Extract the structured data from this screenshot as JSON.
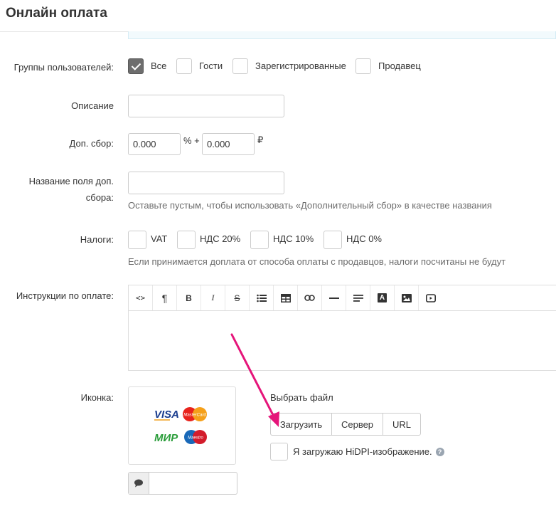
{
  "page": {
    "title": "Онлайн оплата"
  },
  "user_groups": {
    "label": "Группы пользователей:",
    "options": [
      {
        "label": "Все",
        "checked": true
      },
      {
        "label": "Гости",
        "checked": false
      },
      {
        "label": "Зарегистрированные",
        "checked": false
      },
      {
        "label": "Продавец",
        "checked": false
      }
    ]
  },
  "description": {
    "label": "Описание",
    "value": ""
  },
  "surcharge": {
    "label": "Доп. сбор:",
    "percent_value": "0.000",
    "percent_sign": "% +",
    "fixed_value": "0.000",
    "currency": "₽"
  },
  "surcharge_title": {
    "label_line1": "Название поля доп.",
    "label_line2": "сбора:",
    "value": "",
    "hint": "Оставьте пустым, чтобы использовать «Дополнительный сбор» в качестве названия"
  },
  "taxes": {
    "label": "Налоги:",
    "options": [
      {
        "label": "VAT",
        "checked": false
      },
      {
        "label": "НДС 20%",
        "checked": false
      },
      {
        "label": "НДС 10%",
        "checked": false
      },
      {
        "label": "НДС 0%",
        "checked": false
      }
    ],
    "hint": "Если принимается доплата от способа оплаты с продавцов, налоги посчитаны не будут"
  },
  "instructions": {
    "label": "Инструкции по оплате:",
    "toolbar": [
      {
        "icon": "code-icon",
        "glyph": "<>"
      },
      {
        "icon": "paragraph-icon",
        "glyph": "¶"
      },
      {
        "icon": "bold-icon",
        "glyph": "B"
      },
      {
        "icon": "italic-icon",
        "glyph": "I"
      },
      {
        "icon": "strikethrough-icon",
        "glyph": "S"
      },
      {
        "icon": "unordered-list-icon",
        "glyph": ""
      },
      {
        "icon": "table-icon",
        "glyph": ""
      },
      {
        "icon": "link-icon",
        "glyph": ""
      },
      {
        "icon": "horizontal-rule-icon",
        "glyph": ""
      },
      {
        "icon": "align-icon",
        "glyph": ""
      },
      {
        "icon": "font-color-icon",
        "glyph": "A"
      },
      {
        "icon": "image-icon",
        "glyph": ""
      },
      {
        "icon": "video-icon",
        "glyph": ""
      }
    ]
  },
  "icon_field": {
    "label": "Иконка:",
    "choose_file": "Выбрать файл",
    "buttons": [
      "Загрузить",
      "Сервер",
      "URL"
    ],
    "hidpi_label": "Я загружаю HiDPI-изображение.",
    "help_glyph": "?",
    "brands": [
      "VISA",
      "MasterCard",
      "МИР",
      "Maestro"
    ],
    "alt_value": ""
  },
  "colors": {
    "arrow": "#e5157a",
    "checked": "#6d6d6d"
  }
}
